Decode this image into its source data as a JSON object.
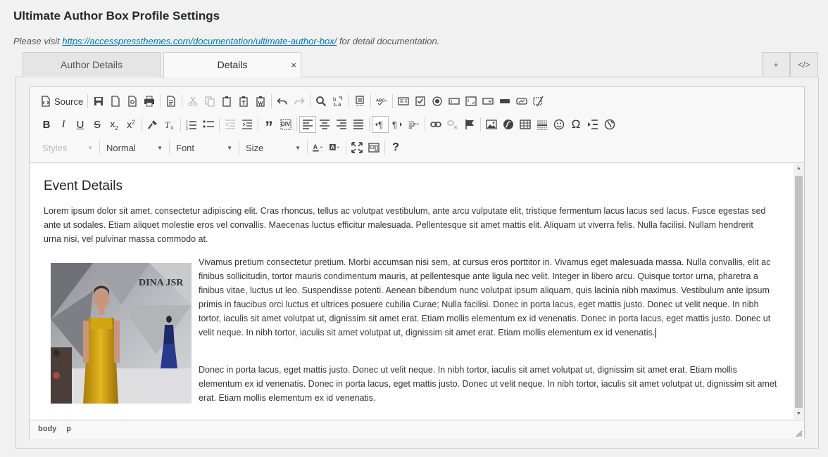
{
  "page": {
    "title": "Ultimate Author Box Profile Settings",
    "note_prefix": "Please visit ",
    "note_link": "https://accesspressthemes.com/documentation/ultimate-author-box/",
    "note_suffix": " for detail documentation."
  },
  "tabs": [
    {
      "label": "Author Details"
    },
    {
      "label": "Details",
      "close": "×"
    }
  ],
  "tab_buttons": {
    "add": "+",
    "code": "</>"
  },
  "toolbar": {
    "source_label": "Source",
    "format_combo": {
      "value": "Normal"
    },
    "styles_combo": {
      "value": "Styles"
    },
    "font_combo": {
      "value": "Font"
    },
    "size_combo": {
      "value": "Size"
    },
    "help": "?"
  },
  "content": {
    "heading": "Event Details",
    "para1": "Lorem ipsum dolor sit amet, consectetur adipiscing elit. Cras rhoncus, tellus ac volutpat vestibulum, ante arcu vulputate elit, tristique fermentum lacus lacus sed lacus. Fusce egestas sed ante ut sodales. Etiam aliquet molestie eros vel convallis. Maecenas luctus efficitur malesuada. Pellentesque sit amet mattis elit. Aliquam ut viverra felis. Nulla facilisi. Nullam hendrerit urna nisi, vel pulvinar massa commodo at.",
    "para2": "Vivamus pretium consectetur pretium. Morbi accumsan nisi sem, at cursus eros porttitor in. Vivamus eget malesuada massa. Nulla convallis, elit ac finibus sollicitudin, tortor mauris condimentum mauris, at pellentesque ante ligula nec velit. Integer in libero arcu. Quisque tortor urna, pharetra a finibus vitae, luctus ut leo. Suspendisse potenti. Aenean bibendum nunc volutpat ipsum aliquam, quis lacinia nibh maximus. Vestibulum ante ipsum primis in faucibus orci luctus et ultrices posuere cubilia Curae; Nulla facilisi. Donec in porta lacus, eget mattis justo. Donec ut velit neque. In nibh tortor, iaculis sit amet volutpat ut, dignissim sit amet erat. Etiam mollis elementum ex id venenatis. Donec in porta lacus, eget mattis justo. Donec ut velit neque. In nibh tortor, iaculis sit amet volutpat ut, dignissim sit amet erat. Etiam mollis elementum ex id venenatis.",
    "para3": "Donec in porta lacus, eget mattis justo. Donec ut velit neque. In nibh tortor, iaculis sit amet volutpat ut, dignissim sit amet erat. Etiam mollis elementum ex id venenatis. Donec in porta lacus, eget mattis justo. Donec ut velit neque. In nibh tortor, iaculis sit amet volutpat ut, dignissim sit amet erat. Etiam mollis elementum ex id venenatis.",
    "image_sign": "DINA JSR"
  },
  "statusbar": {
    "path": [
      "body",
      "p"
    ]
  },
  "colors": {
    "link": "#0073aa",
    "dress": "#d4a417"
  }
}
